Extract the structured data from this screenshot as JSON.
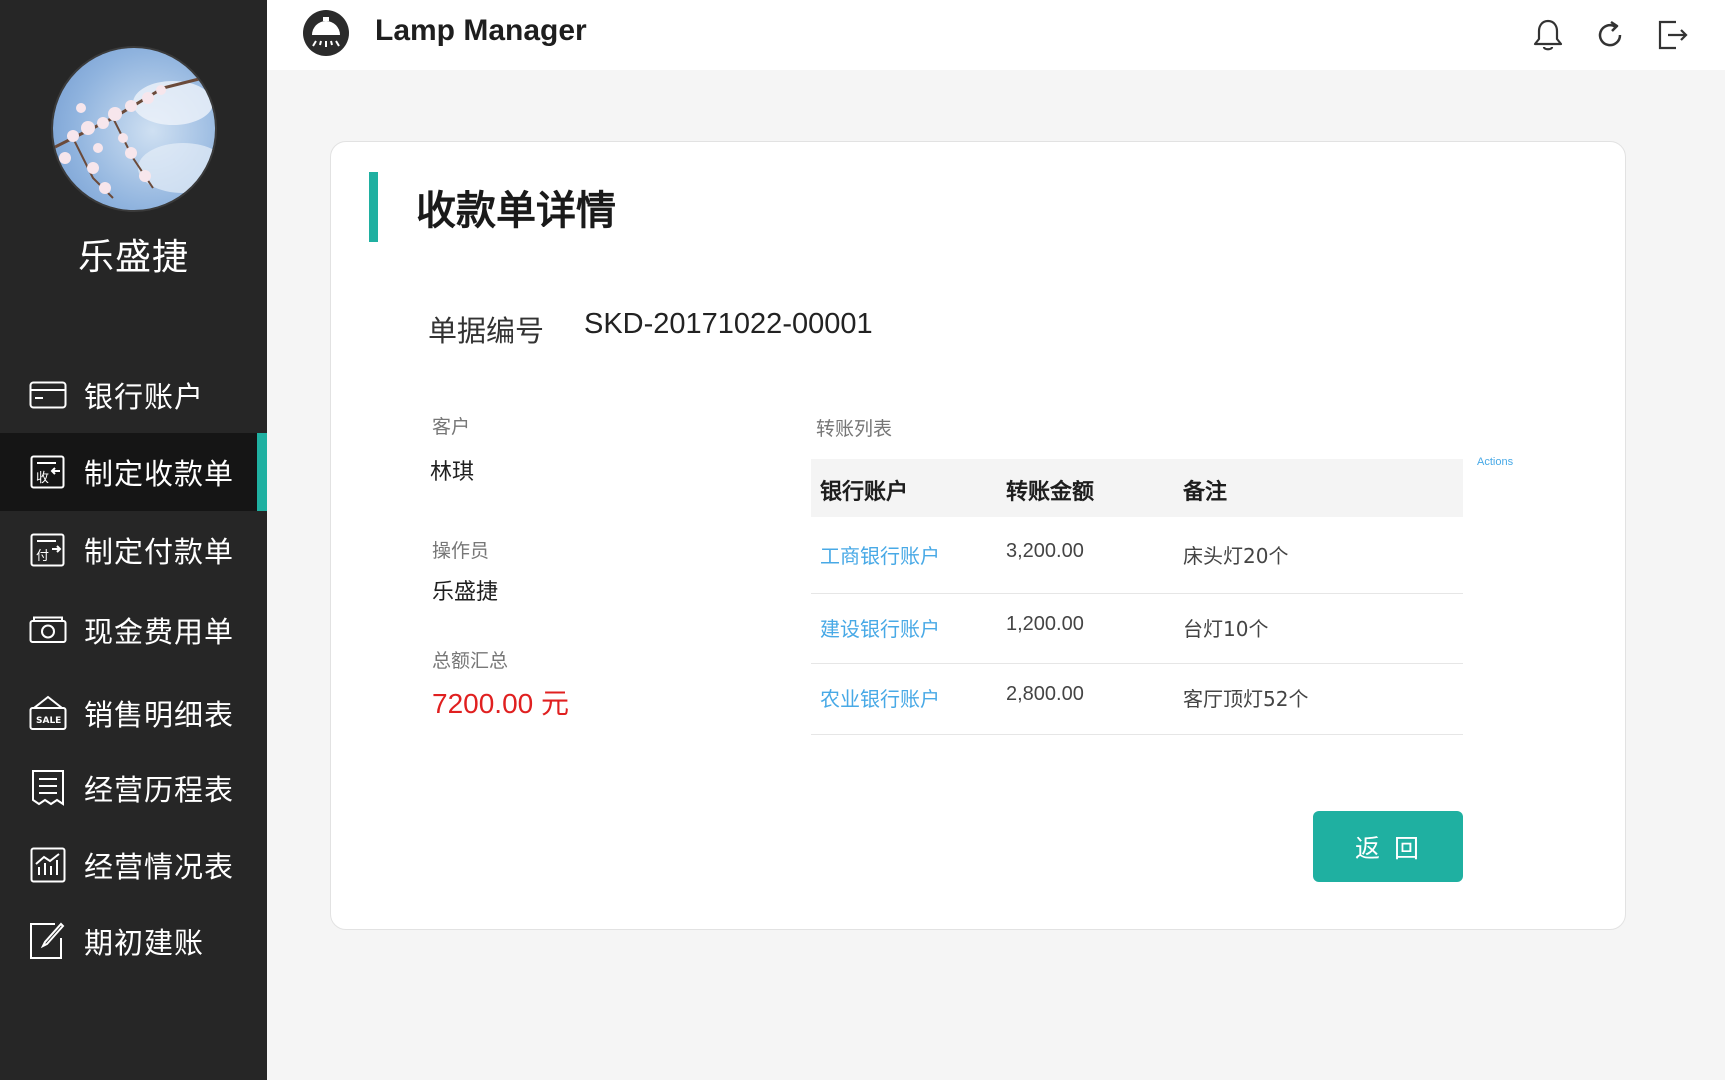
{
  "app": {
    "title": "Lamp Manager"
  },
  "user": {
    "name": "乐盛捷"
  },
  "sidebar": {
    "items": [
      {
        "label": "银行账户",
        "icon": "bank-card-icon",
        "active": false
      },
      {
        "label": "制定收款单",
        "icon": "receipt-icon",
        "active": true
      },
      {
        "label": "制定付款单",
        "icon": "payment-icon",
        "active": false
      },
      {
        "label": "现金费用单",
        "icon": "cash-icon",
        "active": false
      },
      {
        "label": "销售明细表",
        "icon": "sale-icon",
        "active": false
      },
      {
        "label": "经营历程表",
        "icon": "history-icon",
        "active": false
      },
      {
        "label": "经营情况表",
        "icon": "chart-icon",
        "active": false
      },
      {
        "label": "期初建账",
        "icon": "edit-icon",
        "active": false
      }
    ],
    "accent_color": "#1fb0a1"
  },
  "topbar": {
    "icons": [
      "bell-icon",
      "refresh-icon",
      "logout-icon"
    ]
  },
  "page": {
    "title": "收款单详情",
    "doc_label": "单据编号",
    "doc_number": "SKD-20171022-00001"
  },
  "fields": {
    "customer_label": "客户",
    "customer_value": "林琪",
    "operator_label": "操作员",
    "operator_value": "乐盛捷",
    "total_label": "总额汇总",
    "total_value": "7200.00 元"
  },
  "transfers": {
    "label": "转账列表",
    "actions_label": "Actions",
    "headers": [
      "银行账户",
      "转账金额",
      "备注"
    ],
    "rows": [
      {
        "account": "工商银行账户",
        "amount": "3,200.00",
        "note": "床头灯20个"
      },
      {
        "account": "建设银行账户",
        "amount": "1,200.00",
        "note": "台灯10个"
      },
      {
        "account": "农业银行账户",
        "amount": "2,800.00",
        "note": "客厅顶灯52个"
      }
    ]
  },
  "buttons": {
    "back": "返回"
  },
  "colors": {
    "accent": "#1fb0a1",
    "link": "#48a9e6",
    "total": "#e02020"
  }
}
